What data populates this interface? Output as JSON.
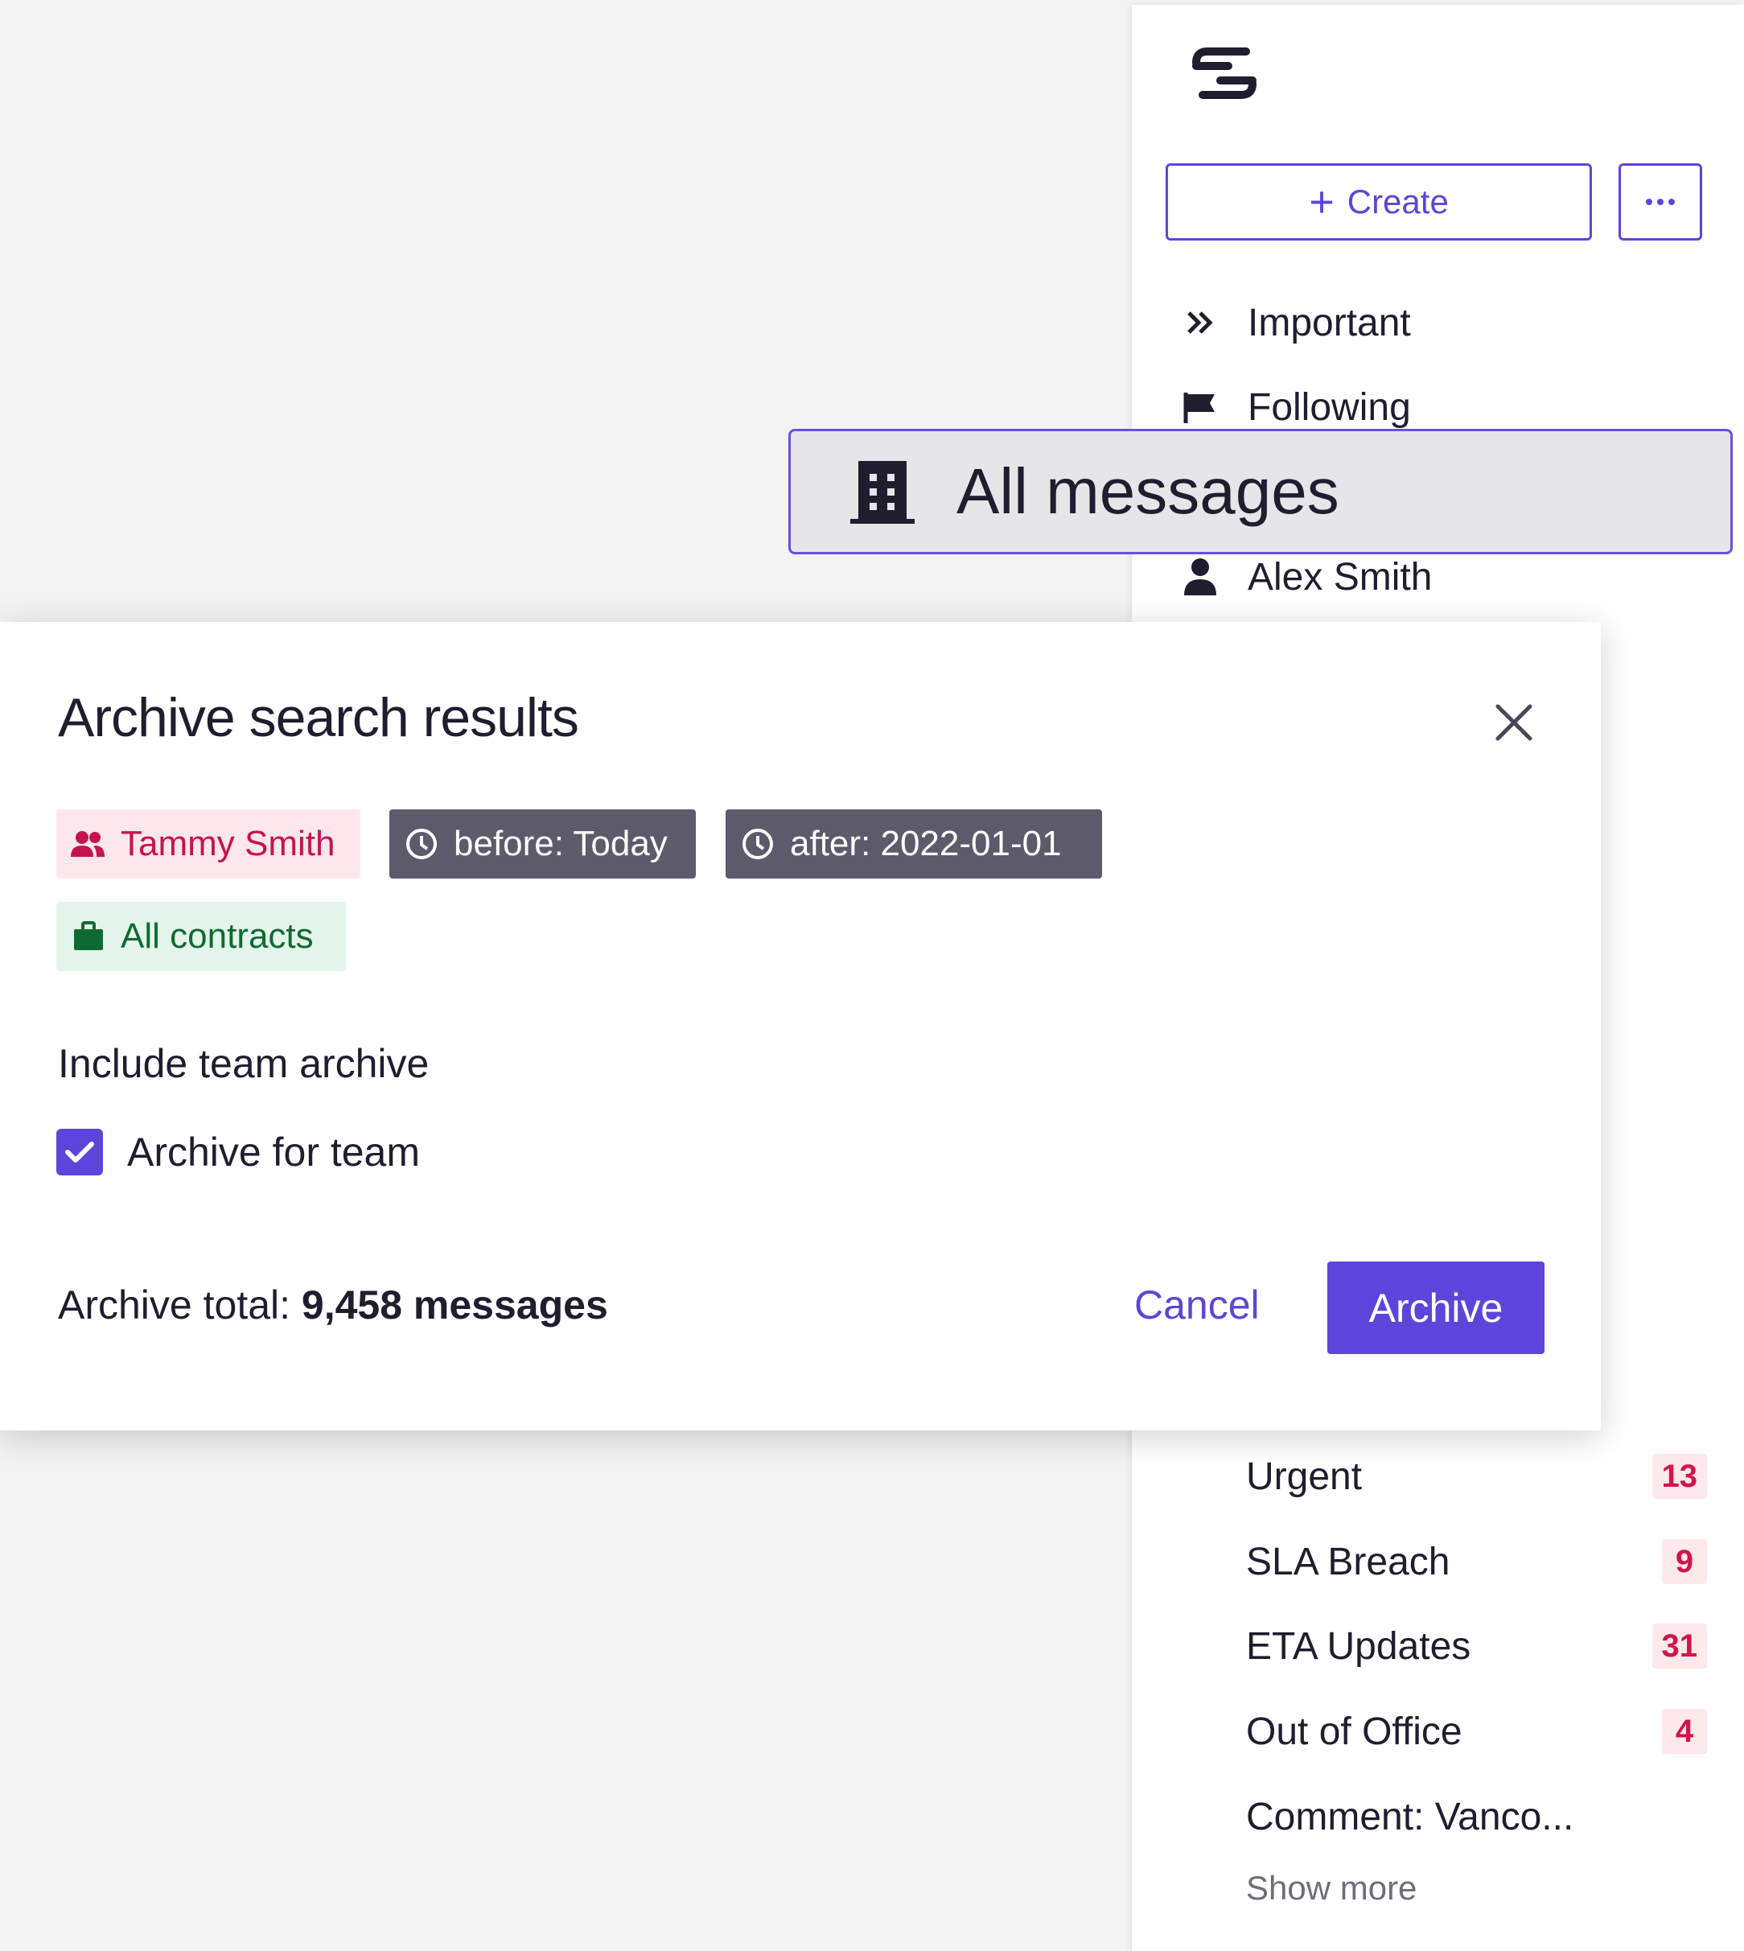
{
  "sidebar": {
    "create_label": "Create",
    "nav": [
      {
        "label": "Important",
        "icon": "double-chevron-right-icon"
      },
      {
        "label": "Following",
        "icon": "flag-icon"
      },
      {
        "label": "Alex Smith",
        "icon": "person-icon"
      }
    ],
    "tags": [
      {
        "label": "Urgent",
        "count": "13"
      },
      {
        "label": "SLA Breach",
        "count": "9"
      },
      {
        "label": "ETA Updates",
        "count": "31"
      },
      {
        "label": "Out of Office",
        "count": "4"
      },
      {
        "label": "Comment: Vanco..."
      }
    ],
    "show_more": "Show more"
  },
  "floating_item": {
    "label": "All messages",
    "icon": "building-icon"
  },
  "modal": {
    "title": "Archive search results",
    "filters": [
      {
        "label": "Tammy Smith",
        "icon": "users-icon",
        "color": "#c6134e"
      },
      {
        "label": "before: Today",
        "icon": "clock-icon"
      },
      {
        "label": "after: 2022-01-01",
        "icon": "clock-icon"
      },
      {
        "label": "All contracts",
        "icon": "briefcase-icon",
        "color": "#0f6a32"
      }
    ],
    "section_heading": "Include team archive",
    "checkbox_label": "Archive for team",
    "checkbox_checked": true,
    "total_prefix": "Archive total:",
    "total_value": "9,458 messages",
    "cancel_label": "Cancel",
    "archive_label": "Archive"
  },
  "colors": {
    "accent": "#5d45db",
    "badge_text": "#d0154a",
    "badge_bg": "#fde8ec"
  }
}
